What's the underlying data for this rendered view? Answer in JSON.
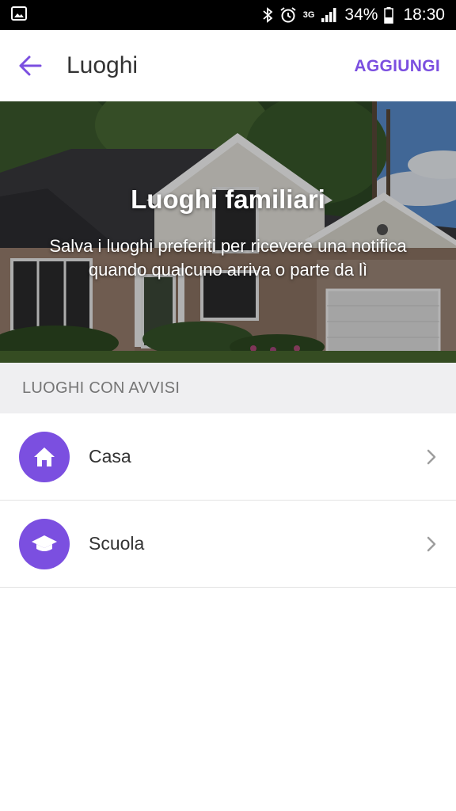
{
  "status_bar": {
    "battery": "34%",
    "time": "18:30",
    "network": "3G",
    "icons": [
      "image-icon",
      "bluetooth-icon",
      "alarm-icon",
      "signal-icon",
      "battery-icon"
    ]
  },
  "app_bar": {
    "title": "Luoghi",
    "action_label": "AGGIUNGI",
    "back_icon": "arrow-left-icon"
  },
  "hero": {
    "title": "Luoghi familiari",
    "subtitle": "Salva i luoghi preferiti per ricevere una notifica quando qualcuno arriva o parte da lì"
  },
  "section": {
    "header": "LUOGHI CON AVVISI"
  },
  "places": [
    {
      "label": "Casa",
      "icon": "home-icon"
    },
    {
      "label": "Scuola",
      "icon": "graduation-cap-icon"
    }
  ],
  "colors": {
    "accent": "#7b4fe0",
    "section_bg": "#efeff1",
    "status_bar": "#000000"
  }
}
